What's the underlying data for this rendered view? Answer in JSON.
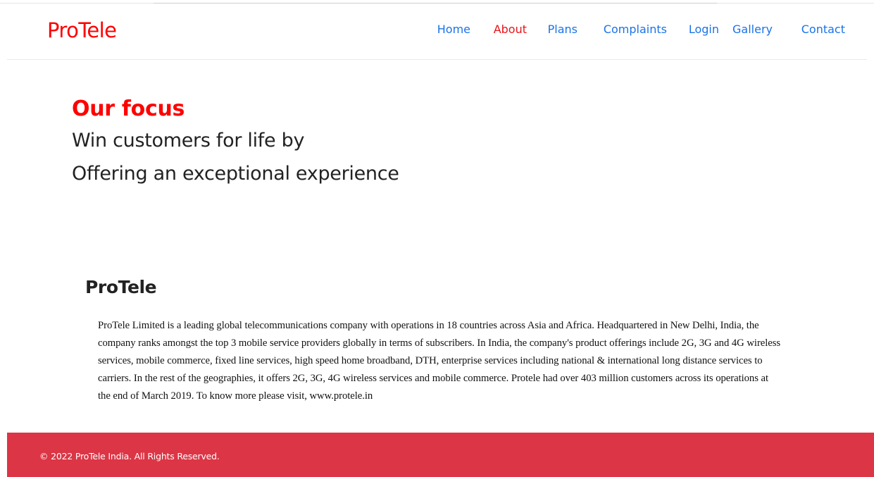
{
  "header": {
    "brand": "ProTele",
    "nav": [
      {
        "label": "Home",
        "active": false
      },
      {
        "label": "About",
        "active": true
      },
      {
        "label": "Plans",
        "active": false
      },
      {
        "label": "Complaints",
        "active": false
      },
      {
        "label": "Login",
        "active": false
      },
      {
        "label": "Gallery",
        "active": false
      },
      {
        "label": "Contact",
        "active": false
      }
    ]
  },
  "focus": {
    "title": "Our focus",
    "line1": "Win customers for life by",
    "line2": "Offering an exceptional experience"
  },
  "about": {
    "title": "ProTele",
    "body": "ProTele Limited is a leading global telecommunications company with operations in 18 countries across Asia and Africa. Headquartered in New Delhi, India, the company ranks amongst the top 3 mobile service providers globally in terms of subscribers. In India, the company's product offerings include 2G, 3G and 4G wireless services, mobile commerce, fixed line services, high speed home broadband, DTH, enterprise services including national & international long distance services to carriers. In the rest of the geographies, it offers 2G, 3G, 4G wireless services and mobile commerce. Protele had over 403 million customers across its operations at the end of March 2019. To know more please visit, www.protele.in"
  },
  "footer": {
    "copyright": "© 2022 ProTele India. All Rights Reserved."
  },
  "colors": {
    "brand": "#ff0000",
    "nav_link": "#1a73e8",
    "nav_active": "#e8141a",
    "footer_bg": "#dc3545"
  }
}
